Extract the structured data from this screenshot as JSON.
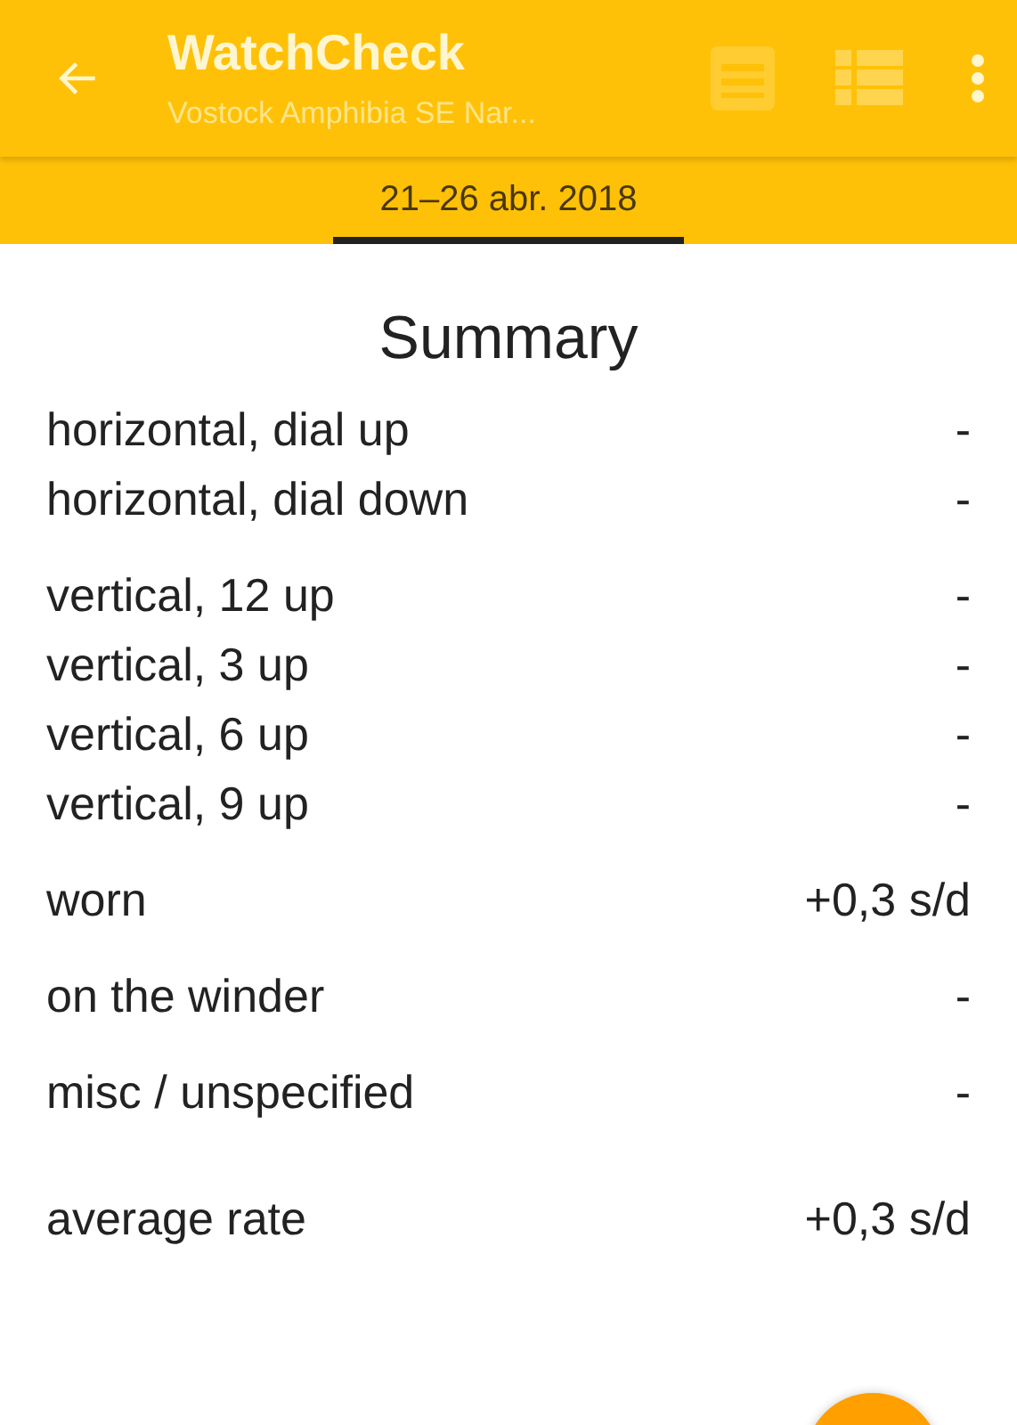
{
  "app_bar": {
    "title": "WatchCheck",
    "subtitle": "Vostock Amphibia SE Nar..."
  },
  "tabs": [
    {
      "label": "21–26 abr. 2018",
      "selected": true
    }
  ],
  "summary": {
    "heading": "Summary",
    "groups": [
      [
        {
          "label": "horizontal, dial up",
          "value": "-"
        },
        {
          "label": "horizontal, dial down",
          "value": "-"
        }
      ],
      [
        {
          "label": "vertical, 12 up",
          "value": "-"
        },
        {
          "label": "vertical, 3 up",
          "value": "-"
        },
        {
          "label": "vertical, 6 up",
          "value": "-"
        },
        {
          "label": "vertical, 9 up",
          "value": "-"
        }
      ],
      [
        {
          "label": "worn",
          "value": "+0,3 s/d"
        }
      ],
      [
        {
          "label": "on the winder",
          "value": "-"
        }
      ],
      [
        {
          "label": "misc / unspecified",
          "value": "-"
        }
      ],
      [
        {
          "label": "average rate",
          "value": "+0,3 s/d"
        }
      ]
    ]
  }
}
